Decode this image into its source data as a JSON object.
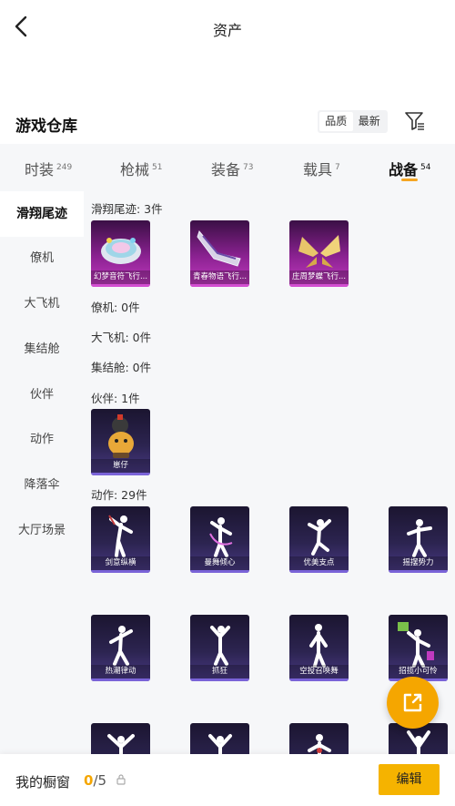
{
  "header": {
    "title": "资产"
  },
  "warehouse": {
    "title": "游戏仓库",
    "sort": [
      "品质",
      "最新"
    ]
  },
  "tabs": [
    {
      "label": "时装",
      "count": "249"
    },
    {
      "label": "枪械",
      "count": "51"
    },
    {
      "label": "装备",
      "count": "73"
    },
    {
      "label": "载具",
      "count": "7"
    },
    {
      "label": "战备",
      "count": "54"
    }
  ],
  "side": [
    "滑翔尾迹",
    "僚机",
    "大飞机",
    "集结舱",
    "伙伴",
    "动作",
    "降落伞",
    "大厅场景"
  ],
  "sections": {
    "glide": "滑翔尾迹: 3件",
    "wing": "僚机: 0件",
    "plane": "大飞机: 0件",
    "capsule": "集结舱: 0件",
    "partner": "伙伴: 1件",
    "emote": "动作: 29件"
  },
  "glide_items": [
    "幻梦音符飞行...",
    "青春物语飞行...",
    "庄周梦蝶飞行..."
  ],
  "partner_items": [
    "崽仔"
  ],
  "emote_items": [
    "剑意纵横",
    "曼舞倾心",
    "优美支点",
    "摇摆势力",
    "热潮律动",
    "抓狂",
    "空投召唤舞",
    "招揽小可怜"
  ],
  "bottom": {
    "label": "我的橱窗",
    "used": "0",
    "total": "/5",
    "edit": "编辑"
  },
  "colors": {
    "accent": "#f5a600",
    "rare_pink": "#c23bc0",
    "epic_purple": "#4a3a86"
  }
}
